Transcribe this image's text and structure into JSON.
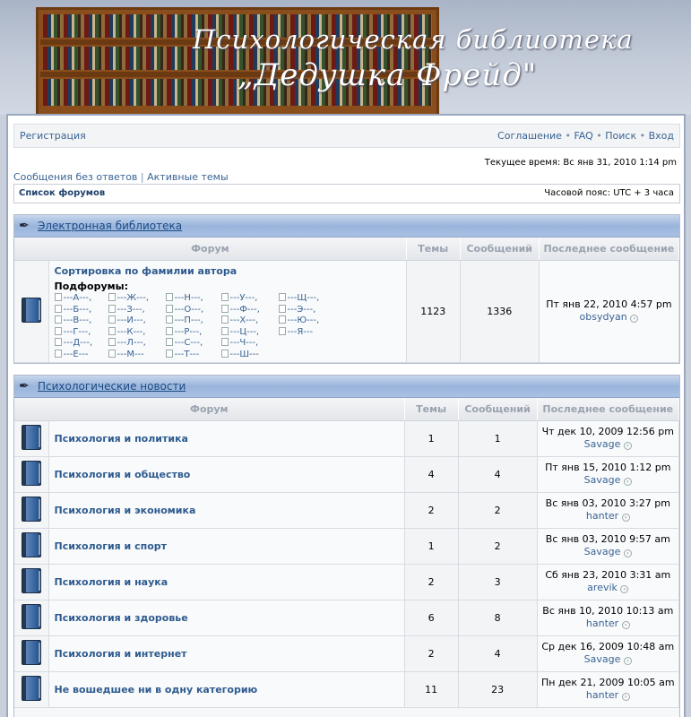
{
  "header": {
    "title_line1": "Психологическая библиотека",
    "title_line2": "„Дедушка Фрейд\""
  },
  "topbar": {
    "register": "Регистрация",
    "agreement": "Соглашение",
    "faq": "FAQ",
    "search": "Поиск",
    "login": "Вход",
    "sep": "•"
  },
  "current_time": "Текущее время: Вс янв 31, 2010 1:14 pm",
  "links": {
    "unanswered": "Сообщения без ответов",
    "divider": "|",
    "active": "Активные темы"
  },
  "nav": {
    "forum_list": "Список форумов",
    "timezone": "Часовой пояс: UTC + 3 часа"
  },
  "columns": {
    "forum": "Форум",
    "topics": "Темы",
    "posts": "Сообщений",
    "last": "Последнее сообщение"
  },
  "cat1": {
    "name": "Электронная библиотека",
    "forum": {
      "name": "Сортировка по фамилии автора",
      "subforums_label": "Подфорумы:",
      "topics": "1123",
      "posts": "1336",
      "last_date": "Пт янв 22, 2010 4:57 pm",
      "last_user": "obsydyan"
    },
    "subforums": [
      "---А---,",
      "---Ж---,",
      "---Н---,",
      "---У---,",
      "---Щ---,",
      "---Б---,",
      "---З---,",
      "---О---,",
      "---Ф---,",
      "---Э---,",
      "---В---,",
      "---И---,",
      "---П---,",
      "---Х---,",
      "---Ю---,",
      "---Г---,",
      "---К---,",
      "---Р---,",
      "---Ц---,",
      "---Я---",
      "---Д---,",
      "---Л---,",
      "---С---,",
      "---Ч---,",
      "",
      "---Е---",
      "---М---",
      "---Т---",
      "---Ш---",
      ""
    ]
  },
  "cat2": {
    "name": "Психологические новости",
    "forums": [
      {
        "name": "Психология и политика",
        "topics": "1",
        "posts": "1",
        "last_date": "Чт дек 10, 2009 12:56 pm",
        "last_user": "Savage"
      },
      {
        "name": "Психология и общество",
        "topics": "4",
        "posts": "4",
        "last_date": "Пт янв 15, 2010 1:12 pm",
        "last_user": "Savage"
      },
      {
        "name": "Психология и экономика",
        "topics": "2",
        "posts": "2",
        "last_date": "Вс янв 03, 2010 3:27 pm",
        "last_user": "hanter"
      },
      {
        "name": "Психология и спорт",
        "topics": "1",
        "posts": "2",
        "last_date": "Вс янв 03, 2010 9:57 am",
        "last_user": "Savage"
      },
      {
        "name": "Психология и наука",
        "topics": "2",
        "posts": "3",
        "last_date": "Сб янв 23, 2010 3:31 am",
        "last_user": "arevik"
      },
      {
        "name": "Психология и здоровье",
        "topics": "6",
        "posts": "8",
        "last_date": "Вс янв 10, 2010 10:13 am",
        "last_user": "hanter"
      },
      {
        "name": "Психология и интернет",
        "topics": "2",
        "posts": "4",
        "last_date": "Ср дек 16, 2009 10:48 am",
        "last_user": "Savage"
      },
      {
        "name": "Не вошедшее ни в одну категорию",
        "topics": "11",
        "posts": "23",
        "last_date": "Пн дек 21, 2009 10:05 am",
        "last_user": "hanter"
      }
    ]
  }
}
